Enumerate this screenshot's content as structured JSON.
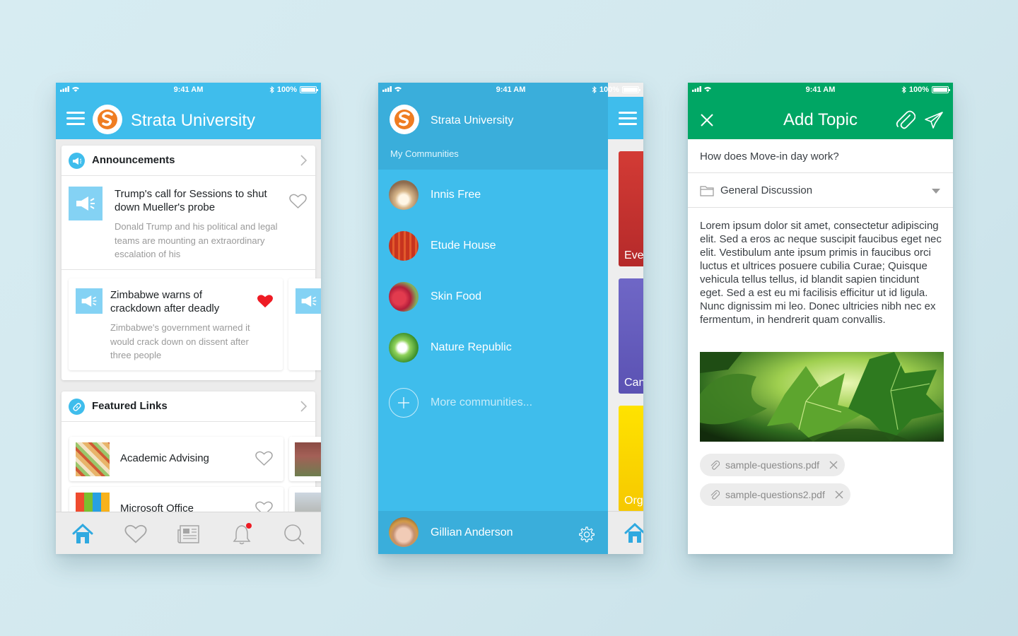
{
  "status_bar": {
    "time": "9:41 AM",
    "battery": "100%"
  },
  "phone1": {
    "app_title": "Strata University",
    "announcements": {
      "heading": "Announcements",
      "items": [
        {
          "title": "Trump's call for Sessions to shut down Mueller's probe",
          "body": "Donald Trump and his political and legal teams are mounting an extraordinary escalation of his",
          "liked": false
        },
        {
          "title": "Zimbabwe warns of crackdown after deadly",
          "body": "Zimbabwe's government warned it would crack down on dissent after three people",
          "liked": true
        }
      ]
    },
    "featured_links": {
      "heading": "Featured Links",
      "items": [
        {
          "label": "Academic Advising"
        },
        {
          "label": "Microsoft Office"
        }
      ]
    },
    "tabs": [
      "home-icon",
      "heart-icon",
      "news-icon",
      "bell-icon",
      "search-icon"
    ]
  },
  "phone2": {
    "app_title": "Strata University",
    "section_label": "My Communities",
    "communities": [
      {
        "label": "Innis Free"
      },
      {
        "label": "Etude House"
      },
      {
        "label": "Skin Food"
      },
      {
        "label": "Nature Republic"
      }
    ],
    "more_label": "More communities...",
    "user_name": "Gillian Anderson",
    "strip_cards": [
      "Eve",
      "Can",
      "Org"
    ]
  },
  "phone3": {
    "title": "Add Topic",
    "question": "How does Move-in day work?",
    "category": "General Discussion",
    "body": "Lorem ipsum dolor sit amet, consectetur adipiscing elit. Sed a eros ac neque suscipit faucibus eget nec elit. Vestibulum ante ipsum primis in faucibus orci luctus et ultrices posuere cubilia Curae; Quisque vehicula tellus tellus, id blandit sapien tincidunt eget. Sed a est eu mi facilisis efficitur ut id ligula. Nunc dignissim mi leo. Donec ultricies nibh nec ex fermentum, in hendrerit quam convallis.",
    "attachments": [
      "sample-questions.pdf",
      "sample-questions2.pdf"
    ]
  },
  "colors": {
    "blue": "#3fbdec",
    "green": "#00a664",
    "like_red": "#ee1b24",
    "orange": "#ef7d22"
  }
}
